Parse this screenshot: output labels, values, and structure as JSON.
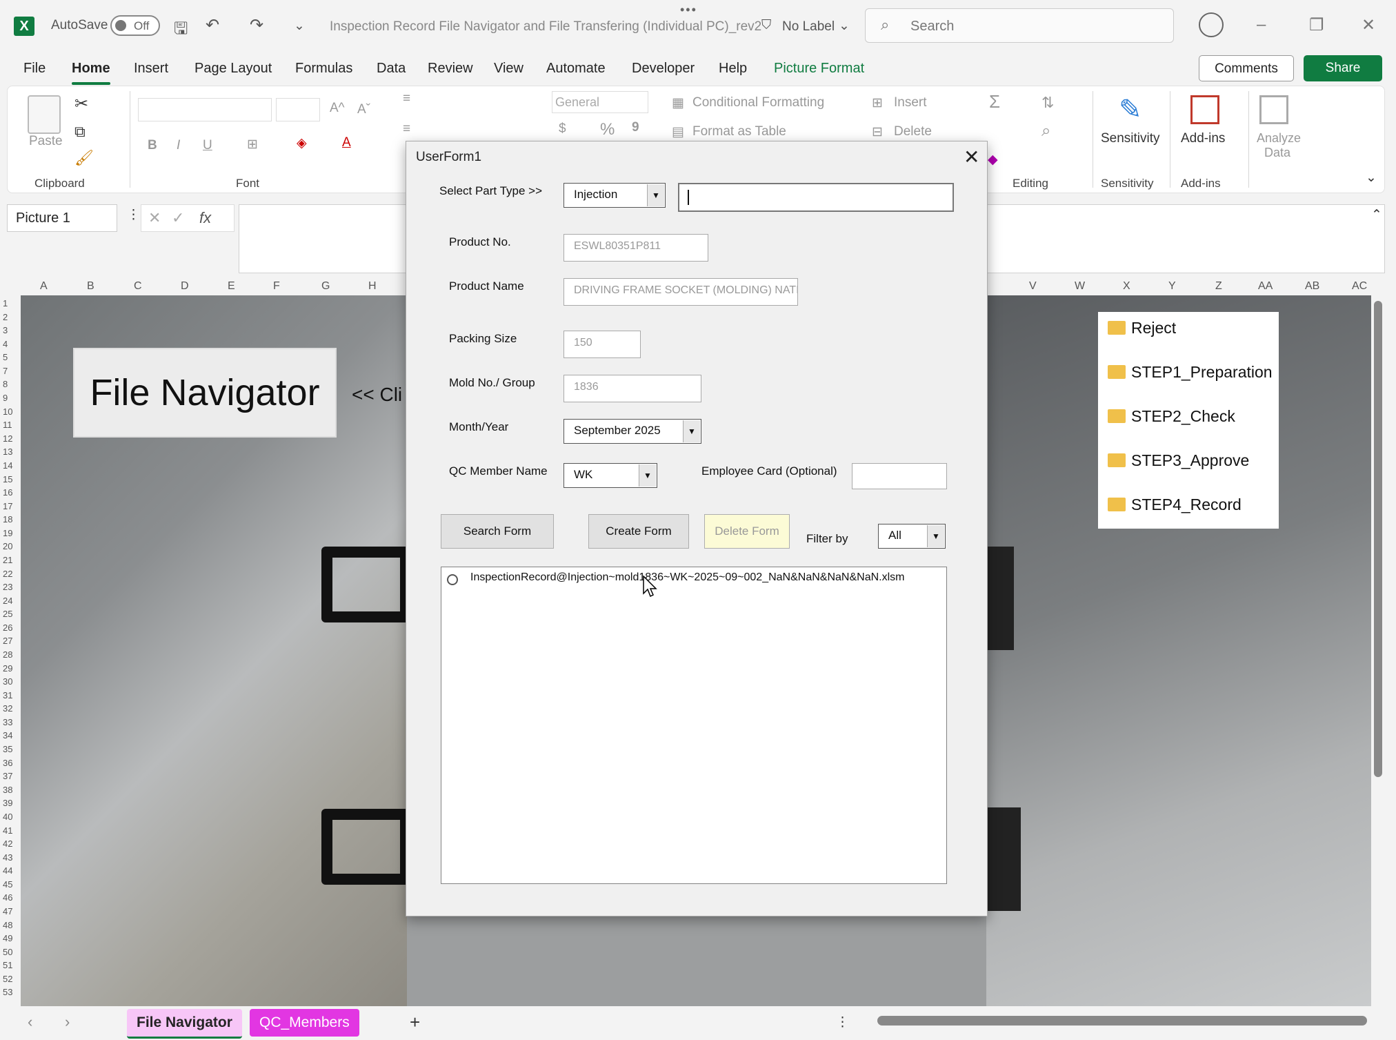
{
  "titlebar": {
    "app_logo": "X",
    "autosave_label": "AutoSave",
    "autosave_state": "Off",
    "doc_title": "Inspection Record File Navigator and File Transfering (Individual PC)_rev2",
    "label_status": "No Label",
    "search_placeholder": "Search",
    "more_dots": "•••"
  },
  "menu": {
    "tabs": [
      "File",
      "Home",
      "Insert",
      "Page Layout",
      "Formulas",
      "Data",
      "Review",
      "View",
      "Automate",
      "Developer",
      "Help",
      "Picture Format"
    ],
    "comments": "Comments",
    "share": "Share"
  },
  "ribbon": {
    "paste": "Paste",
    "clipboard": "Clipboard",
    "font": "Font",
    "number_format": "General",
    "conditional_formatting": "Conditional Formatting",
    "format_as_table": "Format as Table",
    "insert": "Insert",
    "delete": "Delete",
    "editing": "Editing",
    "sensitivity": "Sensitivity",
    "sensitivity_group": "Sensitivity",
    "addins": "Add-ins",
    "addins_group": "Add-ins",
    "analyze_data": "Analyze Data",
    "bold": "B",
    "italic": "I",
    "underline": "U",
    "dollar": "$",
    "percent": "%",
    "comma": "9",
    "sigma": "Σ"
  },
  "formula_bar": {
    "name_box": "Picture 1",
    "fx": "fx"
  },
  "grid": {
    "columns_left": [
      "A",
      "B",
      "C",
      "D",
      "E",
      "F",
      "G",
      "H"
    ],
    "columns_right": [
      "V",
      "W",
      "X",
      "Y",
      "Z",
      "AA",
      "AB",
      "AC"
    ],
    "rows": [
      "1",
      "2",
      "3",
      "4",
      "5",
      "7",
      "8",
      "9",
      "10",
      "11",
      "12",
      "13",
      "14",
      "15",
      "16",
      "17",
      "18",
      "19",
      "20",
      "21",
      "22",
      "23",
      "24",
      "25",
      "26",
      "27",
      "28",
      "29",
      "30",
      "31",
      "32",
      "33",
      "34",
      "35",
      "36",
      "37",
      "38",
      "39",
      "40",
      "41",
      "42",
      "43",
      "44",
      "45",
      "46",
      "47",
      "48",
      "49",
      "50",
      "51",
      "52",
      "53"
    ]
  },
  "sheet": {
    "file_navigator_button": "File Navigator",
    "click_hint": "<< Cli",
    "folders": [
      "Reject",
      "STEP1_Preparation",
      "STEP2_Check",
      "STEP3_Approve",
      "STEP4_Record"
    ]
  },
  "userform": {
    "title": "UserForm1",
    "close": "✕",
    "select_part_type_label": "Select Part Type >>",
    "part_type_value": "Injection",
    "part_type_text": "",
    "product_no_label": "Product No.",
    "product_no_value": "ESWL80351P811",
    "product_name_label": "Product Name",
    "product_name_value": "DRIVING FRAME SOCKET (MOLDING) NATI",
    "packing_size_label": "Packing Size",
    "packing_size_value": "150",
    "mold_no_label": "Mold No./ Group",
    "mold_no_value": "1836",
    "month_year_label": "Month/Year",
    "month_year_value": "September 2025",
    "qc_member_label": "QC Member Name",
    "qc_member_value": "WK",
    "employee_card_label": "Employee Card (Optional)",
    "employee_card_value": "",
    "search_form": "Search Form",
    "create_form": "Create Form",
    "delete_form": "Delete Form",
    "filter_by_label": "Filter by",
    "filter_value": "All",
    "list_items": [
      "InspectionRecord@Injection~mold1836~WK~2025~09~002_NaN&NaN&NaN&NaN.xlsm"
    ]
  },
  "sheet_tabs": {
    "tab1": "File Navigator",
    "tab2": "QC_Members",
    "add": "+"
  }
}
